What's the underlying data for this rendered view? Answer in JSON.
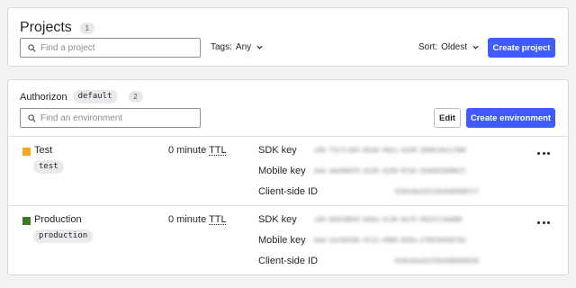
{
  "projects": {
    "title": "Projects",
    "count": "1",
    "search_placeholder": "Find a project",
    "tags_label": "Tags:",
    "tags_value": "Any",
    "sort_label": "Sort:",
    "sort_value": "Oldest",
    "create_button": "Create project"
  },
  "project": {
    "name": "Authorizon",
    "key": "default",
    "env_count": "2",
    "search_placeholder": "Find an environment",
    "edit_button": "Edit",
    "create_button": "Create environment"
  },
  "environments": [
    {
      "name": "Test",
      "key": "test",
      "color": "#f5a524",
      "ttl_value": "0 minute",
      "ttl_unit": "TTL",
      "sdk_key_label": "SDK key",
      "sdk_key": "sdk-75c7c3b5-85a6-49e1-b520-2b89c6e1c500",
      "mobile_key_label": "Mobile key",
      "mobile_key": "mob-abe0b0f6-d130-4230-87eb-5e02819d9b1f",
      "client_id_label": "Client-side ID",
      "client_id": "6181eba32155e4d05b0f17"
    },
    {
      "name": "Production",
      "key": "production",
      "color": "#3d7a26",
      "ttl_value": "0 minute",
      "ttl_unit": "TTL",
      "sdk_key_label": "SDK key",
      "sdk_key": "sdk-6e620043-0eba-4c36-be75-95227c9e800",
      "mobile_key_label": "Mobile key",
      "mobile_key": "mob-ea7d543b-4713-4900-83da-e78239eb67be",
      "client_id_label": "Client-side ID",
      "client_id": "6181eba32155e4d05b0018"
    }
  ],
  "colors": {
    "accent": "#405bff",
    "border": "#d6d8dc",
    "background": "#f2f2f2"
  }
}
